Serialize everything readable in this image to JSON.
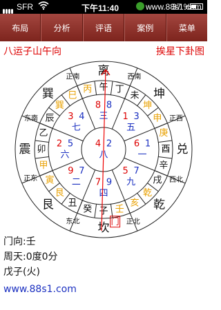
{
  "status": {
    "carrier": "SFR",
    "time": "下午11:40",
    "site": "www.88s1.com",
    "battery": "37 %"
  },
  "nav": {
    "tabs": [
      {
        "label": "布局"
      },
      {
        "label": "分析"
      },
      {
        "label": "评语"
      },
      {
        "label": "案例"
      },
      {
        "label": "菜单"
      }
    ]
  },
  "titles": {
    "left": "八运子山午向",
    "right": "挨星下卦图"
  },
  "chart": {
    "outer": [
      {
        "t": "离",
        "a": 0
      },
      {
        "t": "西南",
        "a": 23
      },
      {
        "t": "坤",
        "a": 45
      },
      {
        "t": "正西",
        "a": 67
      },
      {
        "t": "兑",
        "a": 90
      },
      {
        "t": "西北",
        "a": 113
      },
      {
        "t": "乾",
        "a": 135
      },
      {
        "t": "正北",
        "a": 158
      },
      {
        "t": "坎",
        "a": 180
      },
      {
        "t": "东北",
        "a": 203
      },
      {
        "t": "艮",
        "a": 225
      },
      {
        "t": "正东",
        "a": 248
      },
      {
        "t": "震",
        "a": 270
      },
      {
        "t": "东南",
        "a": 293
      },
      {
        "t": "巽",
        "a": 315
      },
      {
        "t": "正南",
        "a": 337
      }
    ],
    "mountains": [
      {
        "t": "丙",
        "a": -15,
        "c": "#e8a000"
      },
      {
        "t": "午",
        "a": 0,
        "c": "#111"
      },
      {
        "t": "丁",
        "a": 15,
        "c": "#111"
      },
      {
        "t": "未",
        "a": 30,
        "c": "#111"
      },
      {
        "t": "坤",
        "a": 45,
        "c": "#e8a000"
      },
      {
        "t": "申",
        "a": 60,
        "c": "#e8a000"
      },
      {
        "t": "庚",
        "a": 75,
        "c": "#e8a000"
      },
      {
        "t": "酉",
        "a": 90,
        "c": "#111"
      },
      {
        "t": "辛",
        "a": 105,
        "c": "#111"
      },
      {
        "t": "戌",
        "a": 120,
        "c": "#111"
      },
      {
        "t": "乾",
        "a": 135,
        "c": "#e8a000"
      },
      {
        "t": "亥",
        "a": 150,
        "c": "#e8a000"
      },
      {
        "t": "壬",
        "a": 165,
        "c": "#e8a000"
      },
      {
        "t": "子",
        "a": 180,
        "c": "#111"
      },
      {
        "t": "癸",
        "a": 195,
        "c": "#111"
      },
      {
        "t": "丑",
        "a": 210,
        "c": "#111"
      },
      {
        "t": "艮",
        "a": 225,
        "c": "#e8a000"
      },
      {
        "t": "寅",
        "a": 240,
        "c": "#e8a000"
      },
      {
        "t": "甲",
        "a": 255,
        "c": "#e8a000"
      },
      {
        "t": "卯",
        "a": 270,
        "c": "#111"
      },
      {
        "t": "乙",
        "a": 285,
        "c": "#111"
      },
      {
        "t": "辰",
        "a": 300,
        "c": "#111"
      },
      {
        "t": "巽",
        "a": 315,
        "c": "#e8a000"
      },
      {
        "t": "巳",
        "a": 330,
        "c": "#e8a000"
      }
    ],
    "palaces": [
      {
        "a": 0,
        "mtn": "8",
        "wat": "8",
        "yun": "三"
      },
      {
        "a": 45,
        "mtn": "1",
        "wat": "3",
        "yun": "五"
      },
      {
        "a": 90,
        "mtn": "6",
        "wat": "1",
        "yun": "一"
      },
      {
        "a": 135,
        "mtn": "5",
        "wat": "7",
        "yun": "九"
      },
      {
        "a": 180,
        "mtn": "7",
        "wat": "9",
        "yun": "四"
      },
      {
        "a": 225,
        "mtn": "9",
        "wat": "7",
        "yun": "二"
      },
      {
        "a": 270,
        "mtn": "2",
        "wat": "5",
        "yun": "六"
      },
      {
        "a": 315,
        "mtn": "3",
        "wat": "4",
        "yun": "七"
      },
      {
        "a": -1,
        "mtn": "4",
        "wat": "2",
        "yun": "八"
      }
    ],
    "gate": "门"
  },
  "info": {
    "door": "门向:壬",
    "degrees": "周天:0度0分",
    "branch": "戊子(火)"
  }
}
